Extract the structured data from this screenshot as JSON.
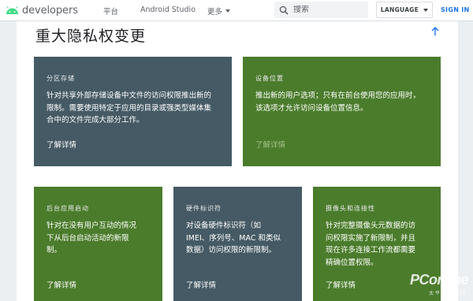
{
  "header": {
    "logo_text": "developers",
    "logo_icon": "android-icon",
    "nav": [
      "平台",
      "Android Studio",
      "更多"
    ],
    "search_placeholder": "搜索",
    "language_label": "LANGUAGE",
    "signin_label": "SIGN IN"
  },
  "page": {
    "title": "重大隐私权变更"
  },
  "tiles": [
    {
      "title": "分区存储",
      "desc": [
        "针对共享外部存储设备中文件的访问权限推出新的",
        "限制。需要使用特定于应用的目录或强类型媒体集",
        "合中的文件完成大部分工作。"
      ],
      "link": "了解详情",
      "color": "#455a64"
    },
    {
      "title": "设备位置",
      "desc": [
        "推出新的用户选项；只有在前台使用您的应用时，",
        "该选项才允许访问设备位置信息。"
      ],
      "link": "了解详情",
      "color": "#4b7c2c"
    },
    {
      "title": "后台应用启动",
      "desc": [
        "针对在没有用户互动的情况",
        "下从后台启动活动的新限",
        "制。"
      ],
      "link": "了解详情",
      "color": "#4b7c2c"
    },
    {
      "title": "硬件标识符",
      "desc": [
        "对设备硬件标识符（如",
        "IMEI、序列号、MAC 和类似",
        "数据）访问权限的新限制。"
      ],
      "link": "了解详情",
      "color": "#455a64"
    },
    {
      "title": "摄像头和连接性",
      "desc": [
        "针对完整摄像头元数据的访",
        "问权限实施了新限制，并且",
        "现在许多连接工作流都需要",
        "精确位置权限。"
      ],
      "link": "了解详情",
      "color": "#4b7c2c"
    }
  ],
  "watermark": {
    "brand": "PConline",
    "sub": "太平洋电脑网"
  }
}
